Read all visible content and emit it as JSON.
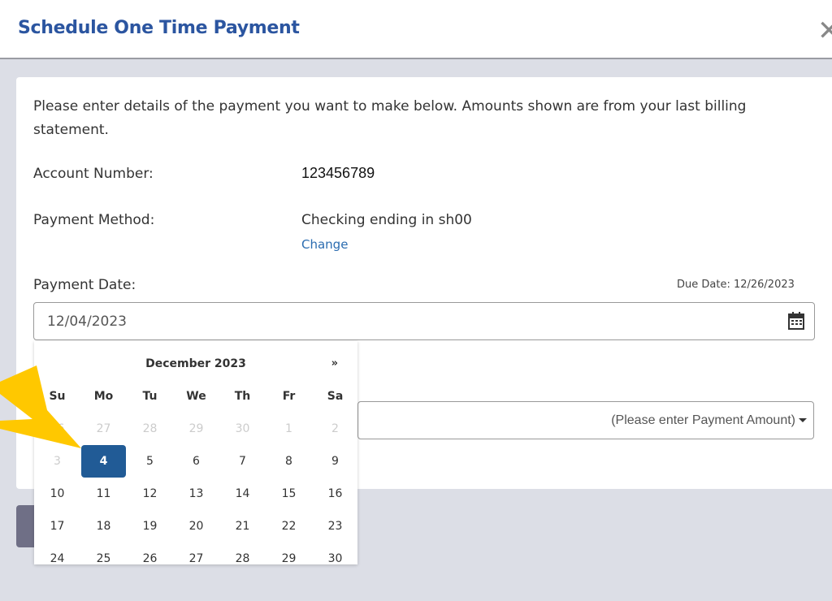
{
  "header": {
    "title": "Schedule One Time Payment",
    "close_icon": "close-icon"
  },
  "form": {
    "intro": "Please enter details of the payment you want to make below. Amounts shown are from your last billing statement.",
    "account_label": "Account Number:",
    "account_value": "123456789",
    "method_label": "Payment Method:",
    "method_value": "Checking ending in sh00",
    "change_link": "Change",
    "date_label": "Payment Date:",
    "due_date": "Due Date: 12/26/2023",
    "date_value": "12/04/2023",
    "amount_placeholder": "(Please enter Payment Amount)"
  },
  "calendar": {
    "month": "December 2023",
    "next": "»",
    "weekdays": [
      "Su",
      "Mo",
      "Tu",
      "We",
      "Th",
      "Fr",
      "Sa"
    ],
    "days": [
      [
        "26",
        "27",
        "28",
        "29",
        "30",
        "1",
        "2"
      ],
      [
        "3",
        "4",
        "5",
        "6",
        "7",
        "8",
        "9"
      ],
      [
        "10",
        "11",
        "12",
        "13",
        "14",
        "15",
        "16"
      ],
      [
        "17",
        "18",
        "19",
        "20",
        "21",
        "22",
        "23"
      ],
      [
        "24",
        "25",
        "26",
        "27",
        "28",
        "29",
        "30"
      ]
    ],
    "selected": "4"
  },
  "colors": {
    "accent": "#215b96",
    "title": "#2b55a0",
    "arrow": "#ffc800"
  }
}
